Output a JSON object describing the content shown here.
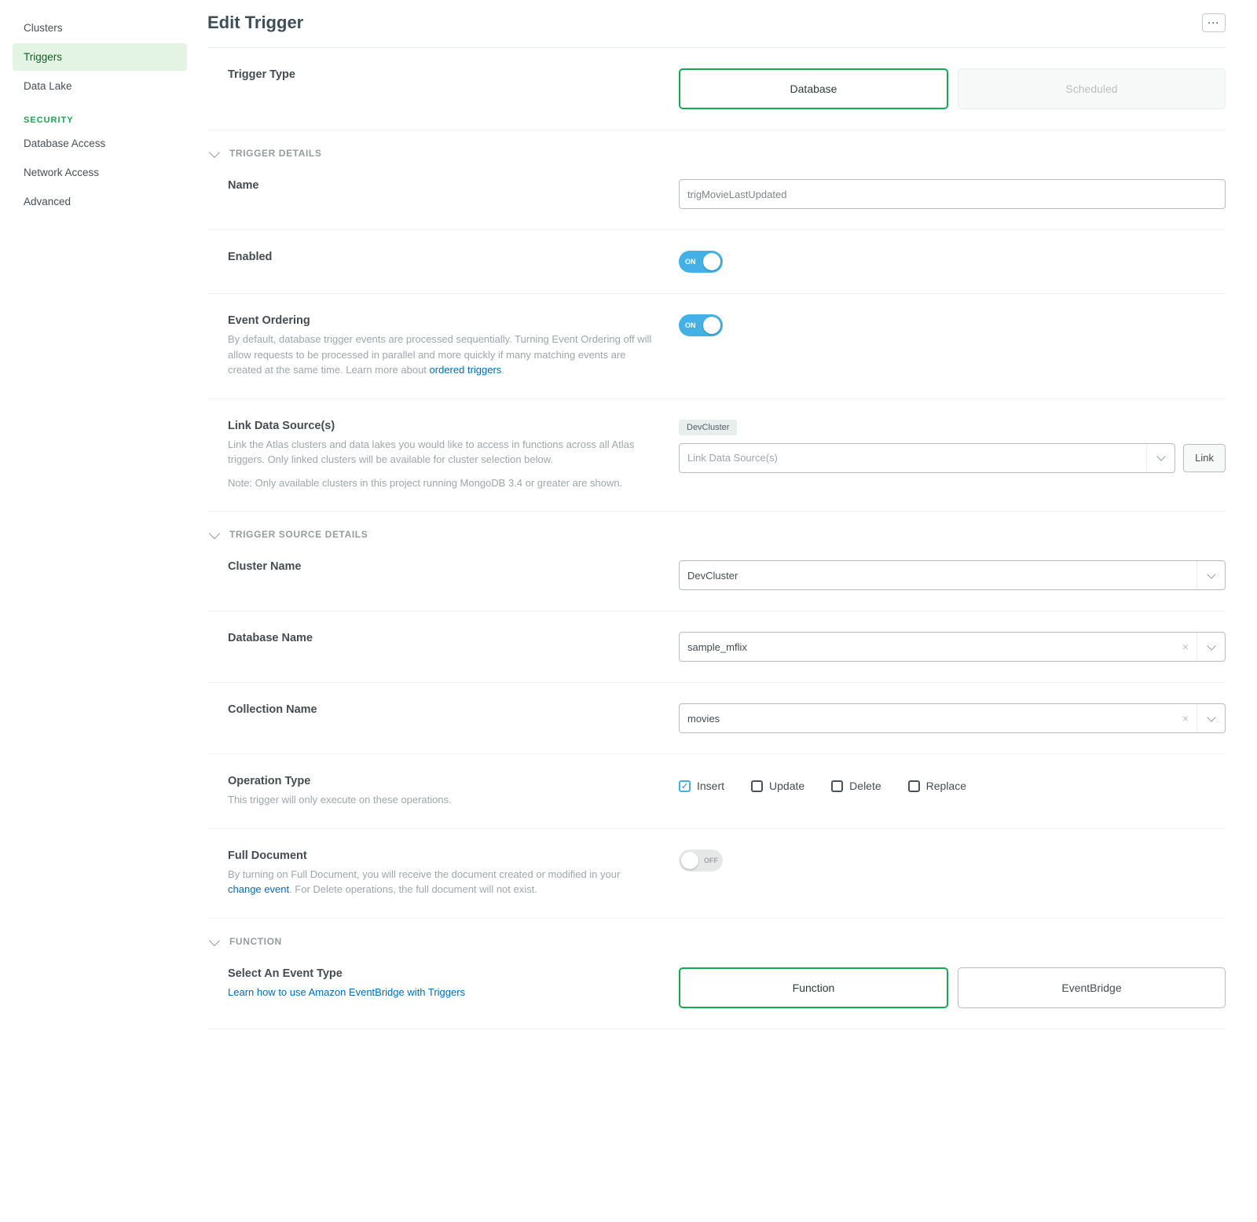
{
  "sidebar": {
    "items": [
      {
        "label": "Clusters",
        "active": false
      },
      {
        "label": "Triggers",
        "active": true
      },
      {
        "label": "Data Lake",
        "active": false
      }
    ],
    "security_header": "SECURITY",
    "security_items": [
      {
        "label": "Database Access"
      },
      {
        "label": "Network Access"
      },
      {
        "label": "Advanced"
      }
    ]
  },
  "page": {
    "title": "Edit Trigger"
  },
  "trigger_type": {
    "label": "Trigger Type",
    "options": {
      "database": "Database",
      "scheduled": "Scheduled"
    }
  },
  "section_headers": {
    "details": "TRIGGER DETAILS",
    "source": "TRIGGER SOURCE DETAILS",
    "function": "FUNCTION"
  },
  "details": {
    "name": {
      "label": "Name",
      "value": "trigMovieLastUpdated"
    },
    "enabled": {
      "label": "Enabled",
      "state": "ON"
    },
    "ordering": {
      "label": "Event Ordering",
      "desc_a": "By default, database trigger events are processed sequentially. Turning Event Ordering off will allow requests to be processed in parallel and more quickly if many matching events are created at the same time. Learn more about ",
      "desc_link": "ordered triggers",
      "desc_b": ".",
      "state": "ON"
    },
    "link_ds": {
      "label": "Link Data Source(s)",
      "desc_a": "Link the Atlas clusters and data lakes you would like to access in functions across all Atlas triggers. Only linked clusters will be available for cluster selection below.",
      "desc_b": "Note: Only available clusters in this project running MongoDB 3.4 or greater are shown.",
      "chip": "DevCluster",
      "placeholder": "Link Data Source(s)",
      "link_btn": "Link"
    }
  },
  "source": {
    "cluster": {
      "label": "Cluster Name",
      "value": "DevCluster"
    },
    "database": {
      "label": "Database Name",
      "value": "sample_mflix"
    },
    "collection": {
      "label": "Collection Name",
      "value": "movies"
    },
    "op_type": {
      "label": "Operation Type",
      "desc": "This trigger will only execute on these operations.",
      "options": {
        "insert": "Insert",
        "update": "Update",
        "delete": "Delete",
        "replace": "Replace"
      }
    },
    "full_doc": {
      "label": "Full Document",
      "desc_a": "By turning on Full Document, you will receive the document created or modified in your ",
      "desc_link": "change event",
      "desc_b": ". For Delete operations, the full document will not exist.",
      "state": "OFF"
    }
  },
  "function": {
    "select_label": "Select An Event Type",
    "learn_link": "Learn how to use Amazon EventBridge with Triggers",
    "options": {
      "function": "Function",
      "eventbridge": "EventBridge"
    }
  }
}
